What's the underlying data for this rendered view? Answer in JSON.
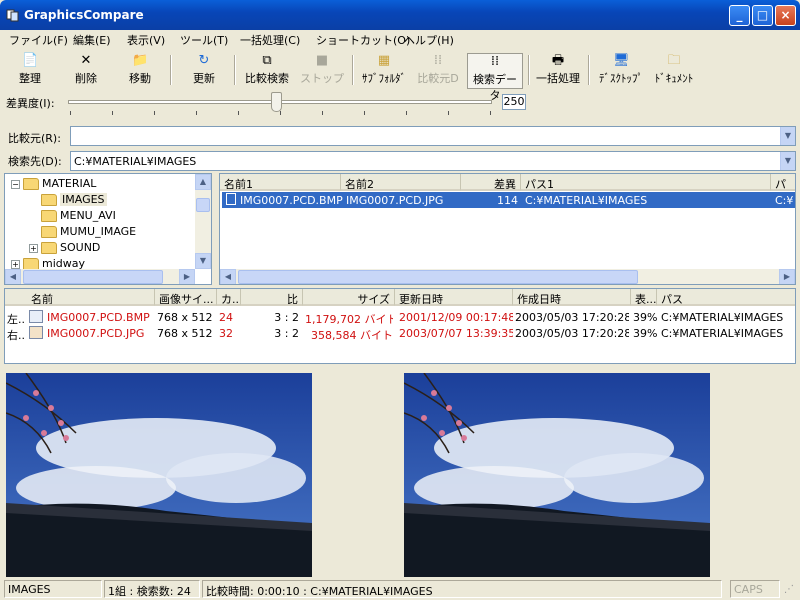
{
  "window": {
    "title": "GraphicsCompare"
  },
  "menu": [
    "ファイル(F)",
    "編集(E)",
    "表示(V)",
    "ツール(T)",
    "一括処理(C)",
    "ショートカット(O)",
    "ヘルプ(H)"
  ],
  "toolbar": {
    "organize": "整理",
    "delete": "削除",
    "move": "移動",
    "refresh": "更新",
    "compare_search": "比較検索",
    "stop": "ストップ",
    "subfolder": "ｻﾌﾞﾌｫﾙﾀﾞ",
    "source_d": "比較元D",
    "search_data": "検索データ",
    "batch": "一括処理",
    "desktop": "ﾃﾞｽｸﾄｯﾌﾟ",
    "documents": "ﾄﾞｷｭﾒﾝﾄ"
  },
  "difference": {
    "label": "差異度(I):",
    "value": "250",
    "level": 0.49
  },
  "compare_source": {
    "label": "比較元(R):",
    "value": ""
  },
  "search_target": {
    "label": "検索先(D):",
    "value": "C:¥MATERIAL¥IMAGES"
  },
  "tree": {
    "items": [
      {
        "label": "MATERIAL",
        "indent": 1,
        "expander": "−"
      },
      {
        "label": "IMAGES",
        "indent": 2,
        "expander": "",
        "selected": true
      },
      {
        "label": "MENU_AVI",
        "indent": 2,
        "expander": ""
      },
      {
        "label": "MUMU_IMAGE",
        "indent": 2,
        "expander": ""
      },
      {
        "label": "SOUND",
        "indent": 2,
        "expander": "+"
      },
      {
        "label": "midway",
        "indent": 1,
        "expander": "+"
      }
    ]
  },
  "result_list": {
    "columns": [
      "名前1",
      "名前2",
      "差異",
      "パス1",
      "パ"
    ],
    "rows": [
      {
        "name1": "IMG0007.PCD.BMP",
        "name2": "IMG0007.PCD.JPG",
        "diff": "114",
        "path1": "C:¥MATERIAL¥IMAGES",
        "path2": "C:¥"
      }
    ]
  },
  "detail_list": {
    "columns": [
      "名前",
      "画像サイ...",
      "カ...",
      "比",
      "サイズ",
      "更新日時",
      "作成日時",
      "表...",
      "パス"
    ],
    "rows": [
      {
        "side": "左..",
        "name": "IMG0007.PCD.BMP",
        "dims": "768 x 512",
        "color": "24",
        "ratio": "3 :   2",
        "size": "1,179,702 バイト",
        "modified": "2001/12/09 00:17:48",
        "created": "2003/05/03 17:20:28",
        "display": "39%",
        "path": "C:¥MATERIAL¥IMAGES"
      },
      {
        "side": "右..",
        "name": "IMG0007.PCD.JPG",
        "dims": "768 x 512",
        "color": "32",
        "ratio": "3 :   2",
        "size": "358,584 バイト",
        "modified": "2003/07/07 13:39:35",
        "created": "2003/05/03 17:20:28",
        "display": "39%",
        "path": "C:¥MATERIAL¥IMAGES"
      }
    ]
  },
  "status": {
    "folder": "IMAGES",
    "count": "1組 : 検索数: 24",
    "time": "比較時間: 0:00:10 : C:¥MATERIAL¥IMAGES",
    "caps": "CAPS"
  }
}
